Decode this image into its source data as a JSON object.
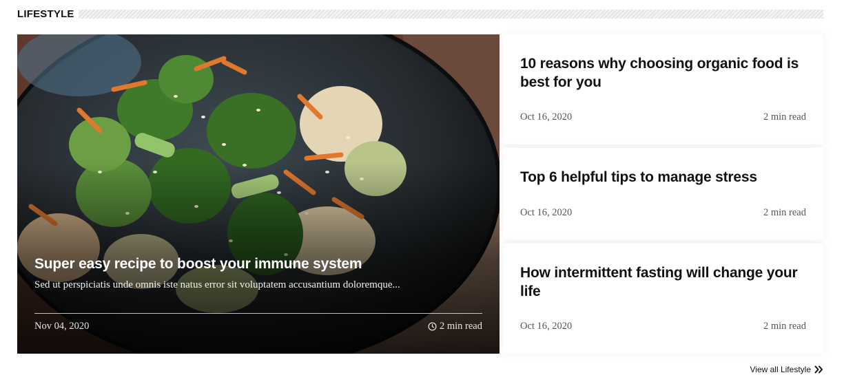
{
  "section": {
    "title": "LIFESTYLE",
    "view_all_label": "View all Lifestyle"
  },
  "feature": {
    "image_icon": "food-photo",
    "title": "Super easy recipe to boost your immune system",
    "excerpt": "Sed ut perspiciatis unde omnis iste natus error sit voluptatem accusantium doloremque...",
    "date": "Nov 04, 2020",
    "read_time": "2 min read",
    "read_icon": "clock-icon"
  },
  "articles": [
    {
      "title": "10 reasons why choosing organic food is best for you",
      "date": "Oct 16, 2020",
      "read_time": "2 min read"
    },
    {
      "title": "Top 6 helpful tips to manage stress",
      "date": "Oct 16, 2020",
      "read_time": "2 min read"
    },
    {
      "title": "How intermittent fasting will change your life",
      "date": "Oct 16, 2020",
      "read_time": "2 min read"
    }
  ],
  "colors": {
    "text": "#111111",
    "meta": "#555555",
    "overlay": "#000000"
  }
}
